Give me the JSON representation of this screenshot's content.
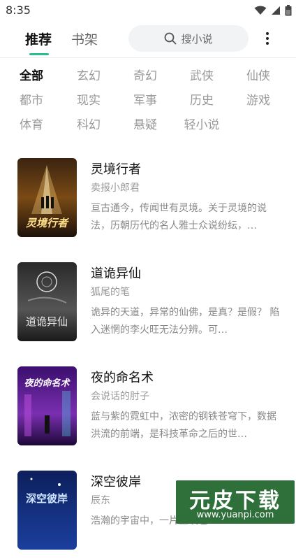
{
  "status": {
    "time": "8:35"
  },
  "header": {
    "tabs": [
      {
        "label": "推荐",
        "active": true
      },
      {
        "label": "书架",
        "active": false
      }
    ],
    "search_placeholder": "搜小说",
    "accent": "#2bbf8a"
  },
  "categories": [
    [
      "全部",
      "玄幻",
      "奇幻",
      "武侠",
      "仙侠"
    ],
    [
      "都市",
      "现实",
      "军事",
      "历史",
      "游戏"
    ],
    [
      "体育",
      "科幻",
      "悬疑",
      "轻小说"
    ]
  ],
  "selected_category": "全部",
  "books": [
    {
      "title": "灵境行者",
      "author": "卖报小郎君",
      "description": "亘古通今，传闻世有灵境。关于灵境的说法，历朝历代的名人雅士众说纷纭，…",
      "cover_text": "灵境行者"
    },
    {
      "title": "道诡异仙",
      "author": "狐尾的笔",
      "description": "诡异的天道，异常的仙佛，是真？是假？ 陷入迷惘的李火旺无法分辨。可…",
      "cover_text": "道诡异仙"
    },
    {
      "title": "夜的命名术",
      "author": "会说话的肘子",
      "description": "蓝与紫的霓虹中，浓密的钢铁苍穹下，数据洪流的前端，是科技革命之后的世…",
      "cover_text": "夜的命名术"
    },
    {
      "title": "深空彼岸",
      "author": "辰东",
      "description": "浩瀚的宇宙中，一片尘埃也…",
      "cover_text": "深空彼岸"
    }
  ],
  "watermark": {
    "text": "元皮下载",
    "url": "www.yuanpi.com"
  }
}
